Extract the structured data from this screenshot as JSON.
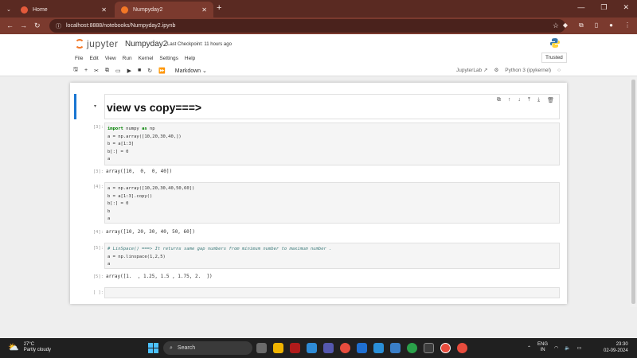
{
  "browser": {
    "tabs": [
      {
        "title": "Home",
        "active": false
      },
      {
        "title": "Numpyday2",
        "active": true
      }
    ],
    "url": "localhost:8888/notebooks/Numpyday2.ipynb"
  },
  "jupyter": {
    "logo_text": "jupyter",
    "notebook_name": "Numpyday2",
    "checkpoint": "Last Checkpoint: 11 hours ago",
    "trusted": "Trusted",
    "menu": [
      "File",
      "Edit",
      "View",
      "Run",
      "Kernel",
      "Settings",
      "Help"
    ],
    "cell_type": "Markdown",
    "jupyterlab_link": "JupyterLab",
    "kernel": "Python 3 (ipykernel)"
  },
  "cells": {
    "markdown_heading": "view vs copy===>",
    "c1": {
      "prompt": "[3]:",
      "out_prompt": "[3]:",
      "output": "array([10,  0,  0, 40])"
    },
    "c2": {
      "prompt": "[4]:",
      "out_prompt": "[4]:",
      "output": "array([10, 20, 30, 40, 50, 60])"
    },
    "c3": {
      "prompt": "[5]:",
      "out_prompt": "[5]:",
      "output": "array([1.  , 1.25, 1.5 , 1.75, 2.  ])"
    },
    "c4": {
      "prompt": "[ ]:"
    }
  },
  "taskbar": {
    "temperature": "27°C",
    "weather": "Partly cloudy",
    "search": "Search",
    "lang1": "ENG",
    "lang2": "IN",
    "time": "23:30",
    "date": "02-09-2024"
  }
}
